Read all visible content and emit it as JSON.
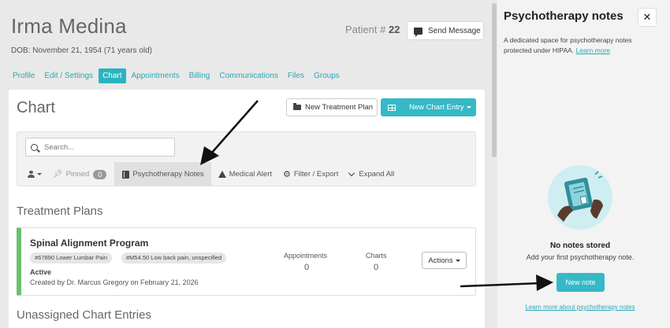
{
  "patient": {
    "name": "Irma Medina",
    "dob": "DOB: November 21, 1954 (71 years old)",
    "number_label": "Patient #",
    "number": "22",
    "send_message": "Send Message"
  },
  "tabs": [
    "Profile",
    "Edit / Settings",
    "Chart",
    "Appointments",
    "Billing",
    "Communications",
    "Files",
    "Groups"
  ],
  "active_tab": "Chart",
  "chart": {
    "title": "Chart",
    "new_treatment_plan": "New Treatment Plan",
    "new_chart_entry": "New Chart Entry",
    "search_placeholder": "Search...",
    "filters": {
      "pinned": "Pinned",
      "pinned_count": "0",
      "psychotherapy_notes": "Psychotherapy Notes",
      "medical_alert": "Medical Alert",
      "filter_export": "Filter / Export",
      "expand_all": "Expand All"
    },
    "treatment_plans_heading": "Treatment Plans",
    "plan": {
      "name": "Spinal Alignment Program",
      "tags": [
        "#67890 Lower Lumbar Pain",
        "#M54.50 Low back pain, unspecified"
      ],
      "status": "Active",
      "created": "Created by Dr. Marcus Gregory on February 21, 2026",
      "appointments_label": "Appointments",
      "appointments_value": "0",
      "charts_label": "Charts",
      "charts_value": "0",
      "actions": "Actions"
    },
    "unassigned_heading": "Unassigned Chart Entries"
  },
  "side_panel": {
    "title": "Psychotherapy notes",
    "close": "✕",
    "description": "A dedicated space for psychotherapy notes protected under HIPAA.",
    "learn_more": "Learn more",
    "empty_title": "No notes stored",
    "empty_subtitle": "Add your first psychotherapy note.",
    "new_note": "New note",
    "learn_more_about": "Learn more about psychotherapy notes"
  },
  "colors": {
    "accent": "#35b9c6",
    "plan_status": "#6cc06e",
    "link": "#2aa7b6"
  }
}
